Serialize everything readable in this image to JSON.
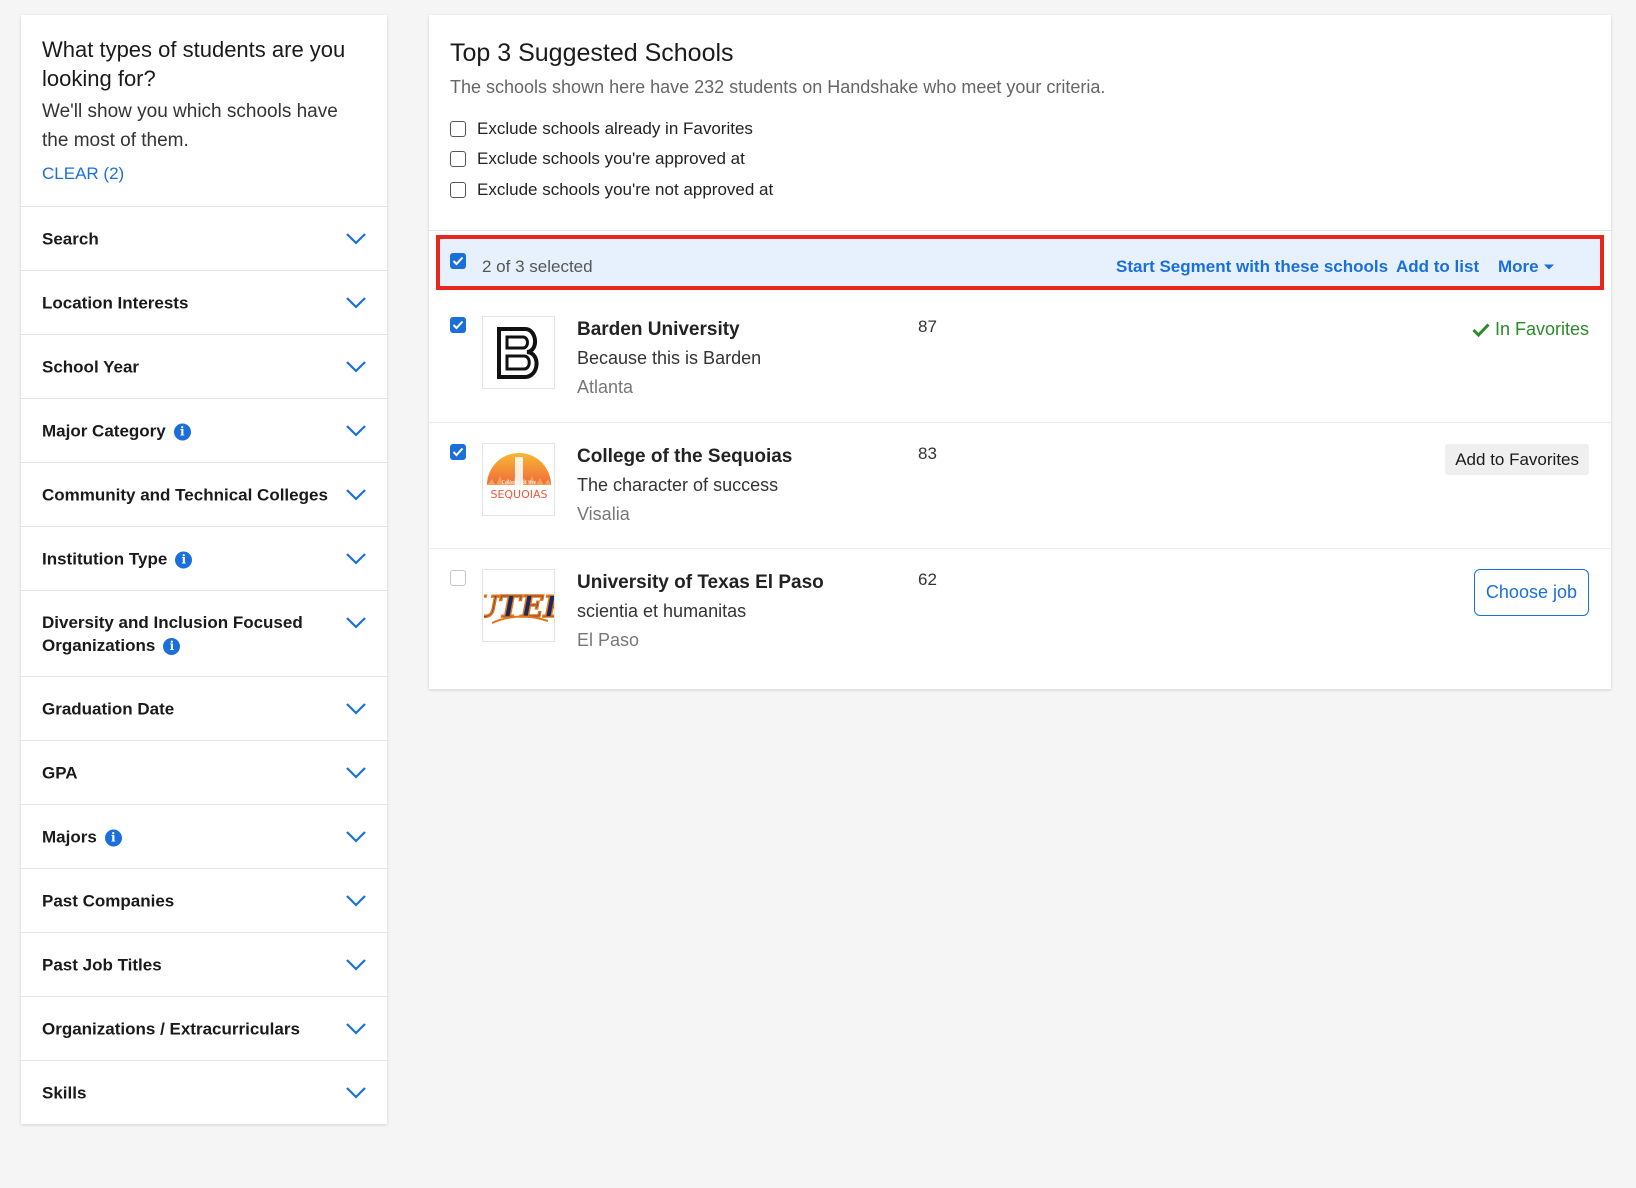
{
  "sidebar": {
    "title": "What types of students are you looking for?",
    "subtitle": "We'll show you which schools have the most of them.",
    "clear_label": "CLEAR (2)",
    "filters": [
      {
        "label": "Search",
        "info": false
      },
      {
        "label": "Location Interests",
        "info": false
      },
      {
        "label": "School Year",
        "info": false
      },
      {
        "label": "Major Category",
        "info": true
      },
      {
        "label": "Community and Technical Colleges",
        "info": false
      },
      {
        "label": "Institution Type",
        "info": true
      },
      {
        "label": "Diversity and Inclusion Focused Organizations",
        "info": true
      },
      {
        "label": "Graduation Date",
        "info": false
      },
      {
        "label": "GPA",
        "info": false
      },
      {
        "label": "Majors",
        "info": true
      },
      {
        "label": "Past Companies",
        "info": false
      },
      {
        "label": "Past Job Titles",
        "info": false
      },
      {
        "label": "Organizations / Extracurriculars",
        "info": false
      },
      {
        "label": "Skills",
        "info": false
      }
    ]
  },
  "main": {
    "title": "Top 3 Suggested Schools",
    "description": "The schools shown here have 232 students on Handshake who meet your criteria.",
    "exclusions": [
      "Exclude schools already in Favorites",
      "Exclude schools you're approved at",
      "Exclude schools you're not approved at"
    ],
    "selection_bar": {
      "selected_text": "2 of 3 selected",
      "start_segment": "Start Segment with these schools",
      "add_to_list": "Add to list",
      "more": "More"
    },
    "schools": [
      {
        "name": "Barden University",
        "tagline": "Because this is Barden",
        "city": "Atlanta",
        "count": "87",
        "checked": true,
        "action": "In Favorites",
        "logo": "B"
      },
      {
        "name": "College of the Sequoias",
        "tagline": "The character of success",
        "city": "Visalia",
        "count": "83",
        "checked": true,
        "action": "Add to Favorites",
        "logo": "SEQUOIAS"
      },
      {
        "name": "University of Texas El Paso",
        "tagline": "scientia et humanitas",
        "city": "El Paso",
        "count": "62",
        "checked": false,
        "action": "Choose job",
        "logo": "UTEP"
      }
    ]
  },
  "colors": {
    "accent": "#1a6fdb",
    "highlight_border": "#e8261c",
    "selection_bg": "#e7f1fd",
    "favorite_green": "#2a8a2a"
  }
}
